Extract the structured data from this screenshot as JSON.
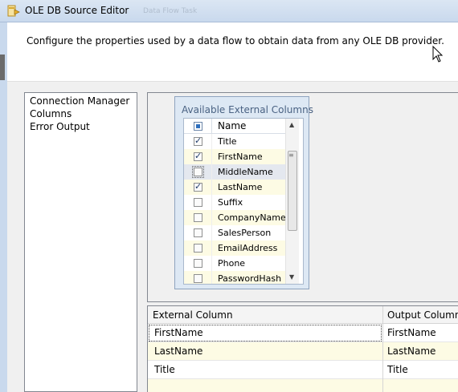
{
  "window": {
    "title": "OLE DB Source Editor",
    "background_tab_hint": "Data Flow Task"
  },
  "header": {
    "description": "Configure the properties used by a data flow to obtain data from any OLE DB provider."
  },
  "nav": {
    "items": [
      {
        "label": "Connection Manager"
      },
      {
        "label": "Columns"
      },
      {
        "label": "Error Output"
      }
    ]
  },
  "available_columns": {
    "title": "Available External Columns",
    "header_label": "Name",
    "rows": [
      {
        "label": "Title",
        "checked": true
      },
      {
        "label": "FirstName",
        "checked": true
      },
      {
        "label": "MiddleName",
        "checked": false
      },
      {
        "label": "LastName",
        "checked": true
      },
      {
        "label": "Suffix",
        "checked": false
      },
      {
        "label": "CompanyName",
        "checked": false
      },
      {
        "label": "SalesPerson",
        "checked": false
      },
      {
        "label": "EmailAddress",
        "checked": false
      },
      {
        "label": "Phone",
        "checked": false
      },
      {
        "label": "PasswordHash",
        "checked": false
      }
    ]
  },
  "mapping_grid": {
    "headers": [
      "External Column",
      "Output Column"
    ],
    "rows": [
      {
        "external": "FirstName",
        "output": "FirstName"
      },
      {
        "external": "LastName",
        "output": "LastName"
      },
      {
        "external": "Title",
        "output": "Title"
      },
      {
        "external": "",
        "output": ""
      }
    ]
  },
  "icons": {
    "title_icon": "ssis-source-icon",
    "cursor": "mouse-pointer-icon",
    "check": "checkmark-icon"
  },
  "colors": {
    "titlebar": "#c9d9ed",
    "avail_box": "#dde8f4",
    "alt_row": "#fdfbe4",
    "avail_title": "#4a6283"
  }
}
